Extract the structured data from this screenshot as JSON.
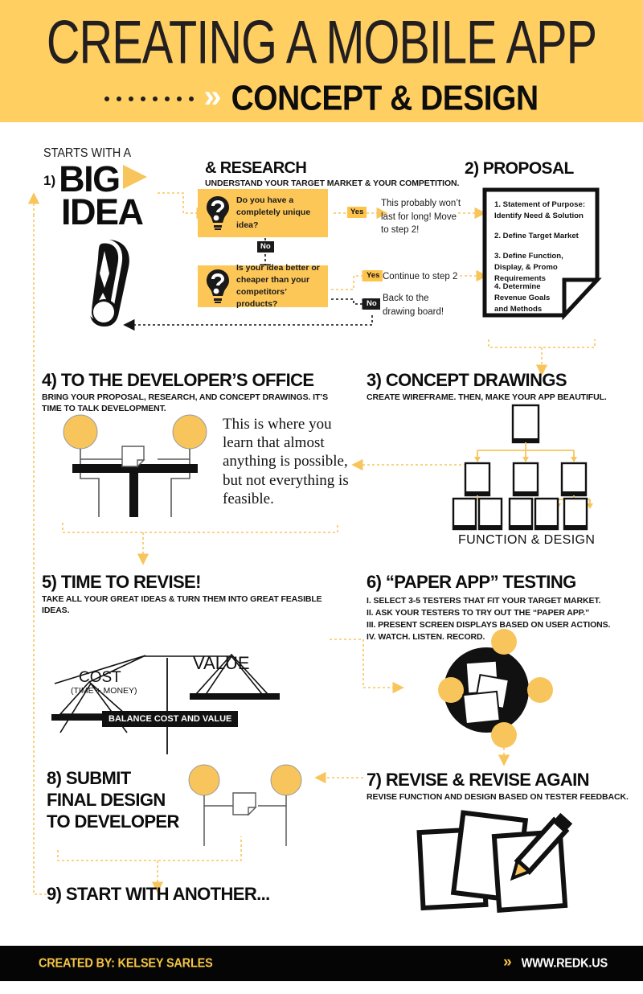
{
  "header": {
    "title": "CREATING A MOBILE APP",
    "subtitle": "CONCEPT & DESIGN",
    "chevron": "»",
    "bg_color": "#FFCF62"
  },
  "colors": {
    "accent_yellow": "#FDC758",
    "arrow_yellow": "#F8C55C",
    "dark": "#111111",
    "header_yellow": "#FFCF62",
    "footer_bg": "#050505",
    "footer_gold": "#F5C544"
  },
  "step1": {
    "kicker": "STARTS WITH A",
    "number": "1)",
    "line1": "BIG",
    "line2": "IDEA",
    "icon": "exclamation-mark-icon"
  },
  "research": {
    "heading": "& RESEARCH",
    "subheading": "UNDERSTAND YOUR TARGET MARKET & YOUR COMPETITION.",
    "q1": "Do you have a completely unique idea?",
    "q2": "Is your idea better or cheaper than your competitors’ products?",
    "q1_yes_badge": "Yes",
    "q1_no_badge": "No",
    "q1_yes_result": "This probably won’t last for long! Move to step 2!",
    "q2_yes_badge": "Yes",
    "q2_no_badge": "No",
    "q2_yes_result": "Continue to step 2",
    "q2_no_result": "Back to the drawing board!"
  },
  "step2": {
    "heading": "2) PROPOSAL",
    "items": [
      "1. Statement of Purpose: Identify Need & Solution",
      "2. Define Target Market",
      "3. Define Function, Display, & Promo Requirements",
      "4. Determine Revenue Goals and Methods"
    ]
  },
  "step3": {
    "heading": "3) CONCEPT DRAWINGS",
    "subheading": "CREATE WIREFRAME. THEN, MAKE YOUR APP BEAUTIFUL.",
    "caption": "FUNCTION &  DESIGN",
    "wireframe_levels": [
      1,
      3,
      5
    ]
  },
  "step4": {
    "heading": "4) TO THE DEVELOPER’S OFFICE",
    "subheading": "BRING YOUR PROPOSAL, RESEARCH, AND CONCEPT DRAWINGS. IT’S TIME TO TALK DEVELOPMENT.",
    "quote": "This is where you learn that almost anything is possible, but not everything is feasible."
  },
  "step5": {
    "heading": "5) TIME TO REVISE!",
    "subheading": "TAKE ALL YOUR GREAT IDEAS & TURN THEM INTO GREAT FEASIBLE IDEAS.",
    "scale_left": "COST",
    "scale_left_sub": "(TIME + MONEY)",
    "scale_right": "VALUE",
    "scale_label": "BALANCE COST AND VALUE"
  },
  "step6": {
    "heading": "6) “PAPER APP” TESTING",
    "lines": [
      "I. SELECT 3-5 TESTERS THAT FIT YOUR TARGET MARKET.",
      "II. ASK YOUR TESTERS TO TRY OUT THE “PAPER APP.”",
      "III. PRESENT SCREEN DISPLAYS BASED ON USER ACTIONS.",
      "IV. WATCH. LISTEN. RECORD."
    ]
  },
  "step7": {
    "heading": "7) REVISE & REVISE AGAIN",
    "subheading": "REVISE FUNCTION AND DESIGN BASED ON TESTER FEEDBACK."
  },
  "step8": {
    "heading_line1": "8) SUBMIT",
    "heading_line2": "FINAL DESIGN",
    "heading_line3": "TO DEVELOPER"
  },
  "step9": {
    "heading": "9) START WITH ANOTHER..."
  },
  "footer": {
    "credit": "CREATED BY: KELSEY SARLES",
    "chevron": "»",
    "url": "WWW.REDK.US"
  }
}
